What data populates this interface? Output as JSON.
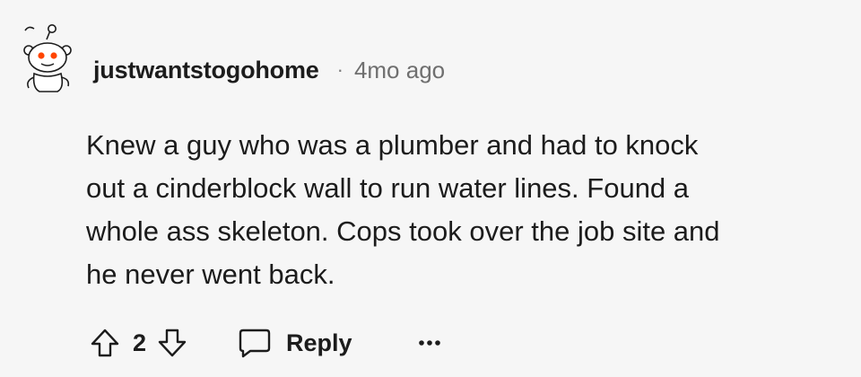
{
  "comment": {
    "author": "justwantstogohome",
    "separator": "·",
    "timestamp": "4mo ago",
    "body_lines": [
      "Knew a guy who was a plumber and had to knock",
      "out a cinderblock wall to run water lines. Found a",
      "whole ass skeleton. Cops took over the job site and",
      "he never went back."
    ],
    "score": "2",
    "reply_label": "Reply"
  },
  "icons": {
    "avatar": "snoo-avatar-icon",
    "upvote": "upvote-arrow-icon",
    "downvote": "downvote-arrow-icon",
    "reply": "speech-bubble-icon",
    "more": "ellipsis-icon"
  },
  "colors": {
    "background": "#f6f6f6",
    "text": "#1c1c1c",
    "muted": "#6f6f6f",
    "avatar_eye": "#ff4500"
  }
}
